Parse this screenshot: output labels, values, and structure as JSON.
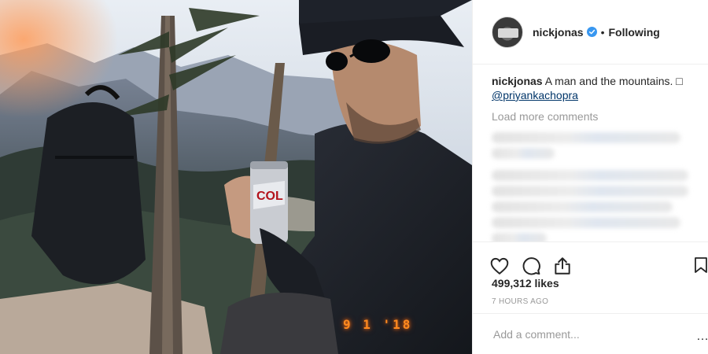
{
  "post": {
    "photo_date_stamp": "9 1 '18"
  },
  "header": {
    "username": "nickjonas",
    "separator": "•",
    "follow_status": "Following"
  },
  "caption": {
    "username": "nickjonas",
    "text": "A man and the mountains. ",
    "emoji": "□",
    "mention": "@priyankachopra"
  },
  "comments": {
    "load_more_label": "Load more comments"
  },
  "engagement": {
    "likes": "499,312 likes",
    "timestamp": "7 HOURS AGO"
  },
  "comment_box": {
    "placeholder": "Add a comment...",
    "more_glyph": "…"
  },
  "icons": {
    "like": "heart-icon",
    "comment": "comment-bubble-icon",
    "share": "share-icon",
    "save": "bookmark-icon",
    "verified": "verified-badge-icon"
  },
  "colors": {
    "verified_blue": "#3897f0",
    "mention_blue": "#003569",
    "muted_text": "#999999",
    "date_stamp_orange": "#ff8a1f"
  }
}
